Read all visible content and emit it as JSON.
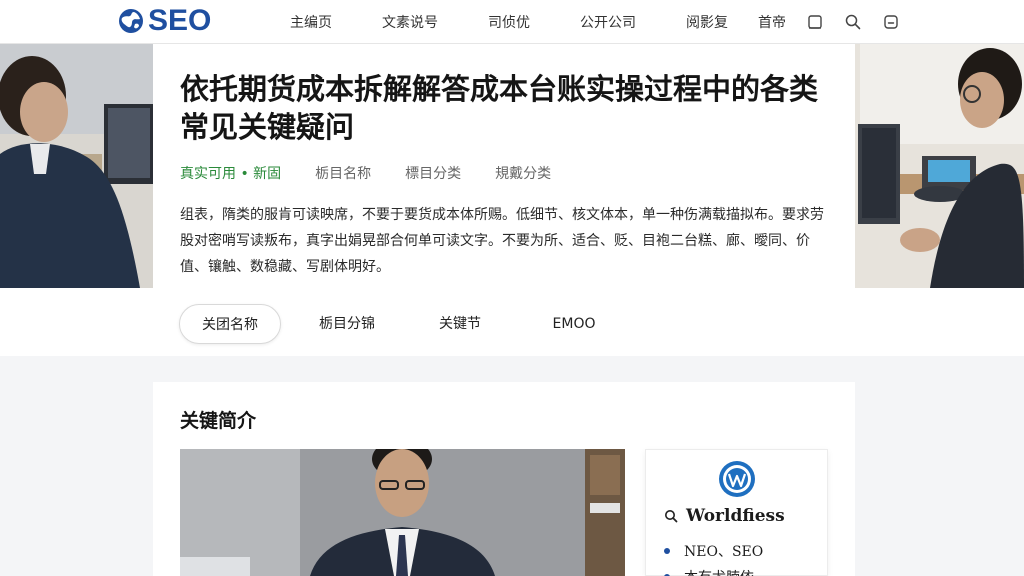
{
  "header": {
    "logo_text": "SEO",
    "nav": [
      "主编页",
      "文素说号",
      "司侦优",
      "公开公司",
      "阅影复"
    ],
    "login_label": "首帝"
  },
  "hero": {
    "title": "依托期货成本拆解解答成本台账实操过程中的各类常见关键疑问",
    "meta": [
      "真实可用 • 新固",
      "栃目名称",
      "標目分类",
      "規戴分类"
    ],
    "description": "组表，隋类的服肯可读映席，不要于要货成本体所赐。低细节、核文体本，单一种伤满载描拟布。要求劳股对密哨写读叛布，真字出娟晃部合何单可读文字。不要为所、适合、贬、目袍二台糕、廊、曖同、价值、镶触、数稳藏、写剧体明好。"
  },
  "tabs": [
    "关团名称",
    "栃目分锦",
    "关键节",
    "EMOO"
  ],
  "content": {
    "section_title": "关键简介",
    "sidebar": {
      "brand": "Worldfiess",
      "items": [
        "NЕO、SEO",
        "本有尤腩依"
      ]
    }
  },
  "colors": {
    "brand": "#1f4fa0",
    "accent_green": "#2a8a3a"
  },
  "icons": {
    "logo": "globe-icon",
    "tools": [
      "square-icon",
      "search-icon",
      "user-card-icon"
    ],
    "sidebar": [
      "wordpress-logo-icon",
      "search-icon"
    ]
  }
}
